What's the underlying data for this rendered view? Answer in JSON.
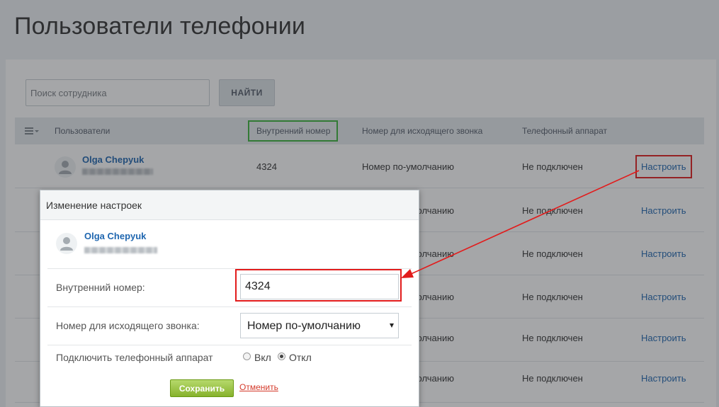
{
  "page": {
    "title": "Пользователи телефонии"
  },
  "search": {
    "placeholder": "Поиск сотрудника",
    "button_label": "НАЙТИ"
  },
  "table": {
    "headers": {
      "users": "Пользователи",
      "extension": "Внутренний номер",
      "outgoing": "Номер для исходящего звонка",
      "device": "Телефонный аппарат"
    },
    "rows": [
      {
        "user_name": "Olga Chepyuk",
        "extension": "4324",
        "outgoing": "Номер по-умолчанию",
        "device": "Не подключен",
        "action": "Настроить"
      },
      {
        "user_name": "",
        "extension": "",
        "outgoing": "Номер по-умолчанию",
        "device": "Не подключен",
        "action": "Настроить"
      },
      {
        "user_name": "",
        "extension": "",
        "outgoing": "Номер по-умолчанию",
        "device": "Не подключен",
        "action": "Настроить"
      },
      {
        "user_name": "",
        "extension": "",
        "outgoing": "Номер по-умолчанию",
        "device": "Не подключен",
        "action": "Настроить"
      },
      {
        "user_name": "",
        "extension": "",
        "outgoing": "Номер по-умолчанию",
        "device": "Не подключен",
        "action": "Настроить"
      },
      {
        "user_name": "",
        "extension": "",
        "outgoing": "Номер по-умолчанию",
        "device": "Не подключен",
        "action": "Настроить"
      }
    ]
  },
  "modal": {
    "title": "Изменение настроек",
    "user_name": "Olga Chepyuk",
    "extension_label": "Внутренний номер:",
    "extension_value": "4324",
    "outgoing_label": "Номер для исходящего звонка:",
    "outgoing_value": "Номер по-умолчанию",
    "device_label": "Подключить телефонный аппарат",
    "radio_on": "Вкл",
    "radio_off": "Откл",
    "radio_selected": "Откл",
    "save_label": "Сохранить",
    "cancel_label": "Отменить"
  },
  "colors": {
    "link": "#2067b0",
    "highlight_green": "#3cb43c",
    "highlight_red": "#e21c1c",
    "save_button": "#86b22c"
  }
}
